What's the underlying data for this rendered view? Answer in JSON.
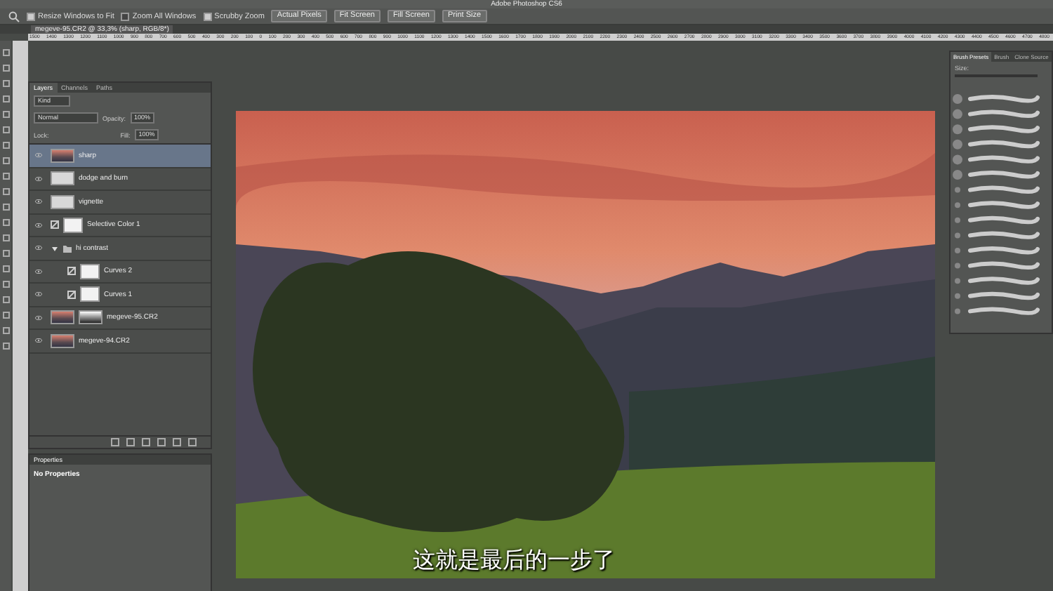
{
  "window": {
    "title": "Adobe Photoshop CS6"
  },
  "options_bar": {
    "checkboxes": [
      {
        "label": "Resize Windows to Fit",
        "checked": true
      },
      {
        "label": "Zoom All Windows",
        "checked": false
      },
      {
        "label": "Scrubby Zoom",
        "checked": true
      }
    ],
    "buttons": [
      "Actual Pixels",
      "Fit Screen",
      "Fill Screen",
      "Print Size"
    ]
  },
  "document_tab": "megeve-95.CR2 @ 33,3% (sharp, RGB/8*)",
  "ruler_labels": [
    "1500",
    "1400",
    "1300",
    "1200",
    "1100",
    "1000",
    "900",
    "800",
    "700",
    "600",
    "500",
    "400",
    "300",
    "200",
    "100",
    "0",
    "100",
    "200",
    "300",
    "400",
    "500",
    "600",
    "700",
    "800",
    "900",
    "1000",
    "1100",
    "1200",
    "1300",
    "1400",
    "1500",
    "1600",
    "1700",
    "1800",
    "1900",
    "2000",
    "2100",
    "2200",
    "2300",
    "2400",
    "2500",
    "2600",
    "2700",
    "2800",
    "2900",
    "3000",
    "3100",
    "3200",
    "3300",
    "3400",
    "3500",
    "3600",
    "3700",
    "3800",
    "3900",
    "4000",
    "4100",
    "4200",
    "4300",
    "4400",
    "4500",
    "4600",
    "4700",
    "4800"
  ],
  "layers_panel": {
    "tabs": [
      {
        "label": "Layers",
        "selected": true
      },
      {
        "label": "Channels",
        "selected": false
      },
      {
        "label": "Paths",
        "selected": false
      }
    ],
    "filter": "Kind",
    "blend_mode": "Normal",
    "opacity_label": "Opacity:",
    "opacity": "100%",
    "lock_label": "Lock:",
    "fill_label": "Fill:",
    "fill": "100%",
    "layers": [
      {
        "kind": "photo",
        "name": "sharp",
        "selected": true
      },
      {
        "kind": "pattern",
        "name": "dodge and burn",
        "selected": false
      },
      {
        "kind": "pattern",
        "name": "vignette",
        "selected": false
      },
      {
        "kind": "adjustment",
        "name": "Selective Color 1",
        "selected": false
      },
      {
        "kind": "group",
        "name": "hi contrast",
        "selected": false,
        "expanded": true,
        "children": [
          {
            "kind": "adjustment",
            "name": "Curves 2",
            "selected": false
          },
          {
            "kind": "adjustment",
            "name": "Curves 1",
            "selected": false
          }
        ]
      },
      {
        "kind": "masked",
        "name": "megeve-95.CR2",
        "selected": false
      },
      {
        "kind": "photo",
        "name": "megeve-94.CR2",
        "selected": false
      }
    ]
  },
  "properties_panel": {
    "title": "Properties",
    "message": "No Properties"
  },
  "brush_panel": {
    "tabs": [
      {
        "label": "Brush Presets",
        "selected": true
      },
      {
        "label": "Brush",
        "selected": false
      },
      {
        "label": "Clone Source",
        "selected": false
      }
    ],
    "size_label": "Size:"
  },
  "subtitle": "这就是最后的一步了"
}
